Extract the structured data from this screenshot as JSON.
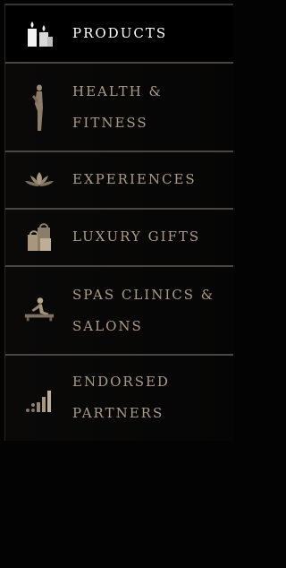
{
  "menu": {
    "items": [
      {
        "label": "PRODUCTS",
        "icon": "candles-icon",
        "active": true
      },
      {
        "label": "HEALTH & FITNESS",
        "icon": "yoga-pose-icon",
        "active": false
      },
      {
        "label": "EXPERIENCES",
        "icon": "lotus-icon",
        "active": false
      },
      {
        "label": "LUXURY GIFTS",
        "icon": "gift-bags-icon",
        "active": false
      },
      {
        "label": "SPAS CLINICS & SALONS",
        "icon": "massage-icon",
        "active": false
      },
      {
        "label": "ENDORSED PARTNERS",
        "icon": "signal-bars-icon",
        "active": false
      }
    ]
  },
  "colors": {
    "active_text": "#ffffff",
    "inactive_text": "#ac9b86",
    "divider": "#4d4640",
    "background": "#030303",
    "icon": "#9a8a76"
  }
}
